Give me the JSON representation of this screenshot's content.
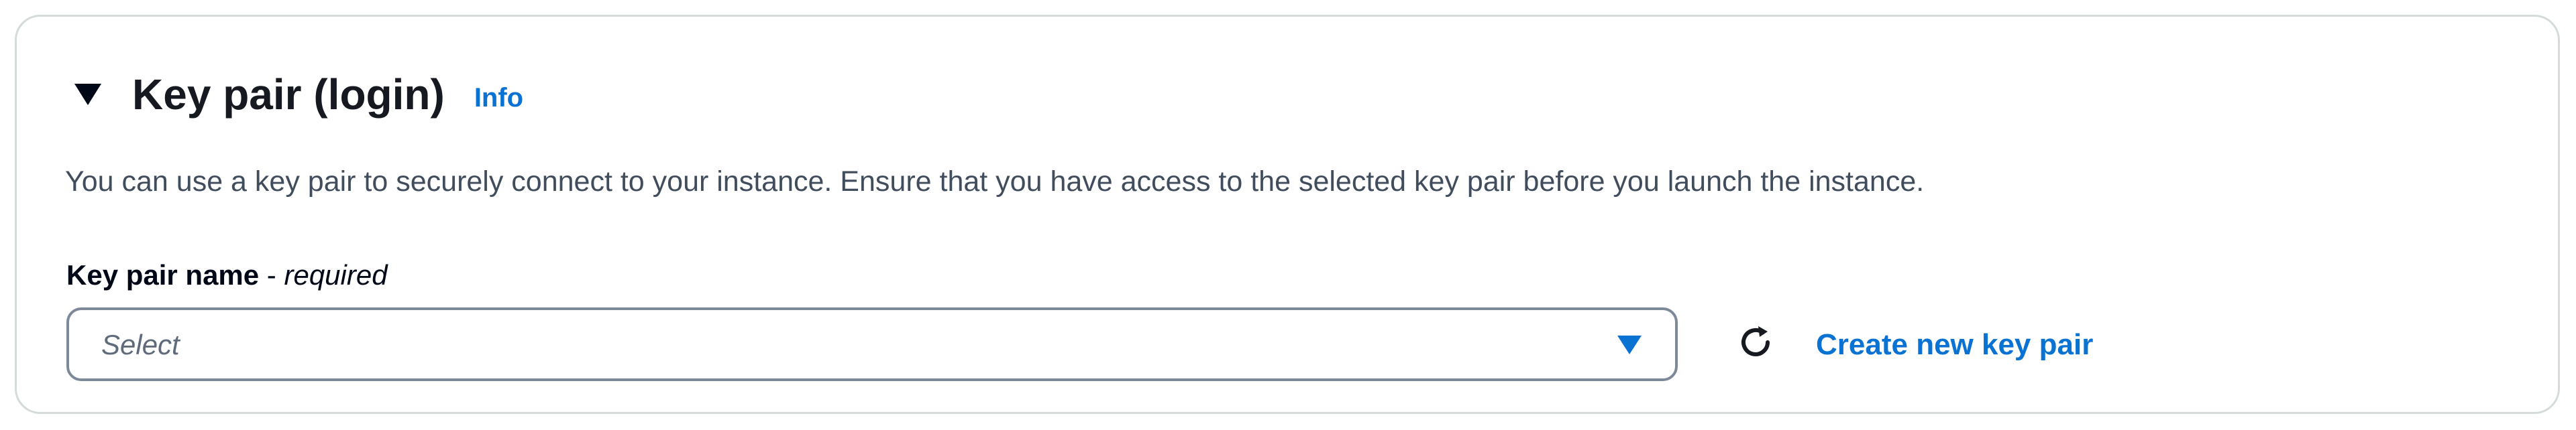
{
  "section": {
    "title": "Key pair (login)",
    "info_label": "Info",
    "description": "You can use a key pair to securely connect to your instance. Ensure that you have access to the selected key pair before you launch the instance."
  },
  "field": {
    "label_name": "Key pair name",
    "label_separator": " - ",
    "label_required": "required",
    "placeholder": "Select"
  },
  "actions": {
    "create_label": "Create new key pair"
  },
  "icons": {
    "expand": "caret-down-filled-icon",
    "dropdown": "caret-down-icon",
    "refresh": "refresh-icon"
  },
  "colors": {
    "link": "#0972d3",
    "text": "#16191f",
    "border": "#d5dbdb",
    "input_border": "#7d8998"
  }
}
